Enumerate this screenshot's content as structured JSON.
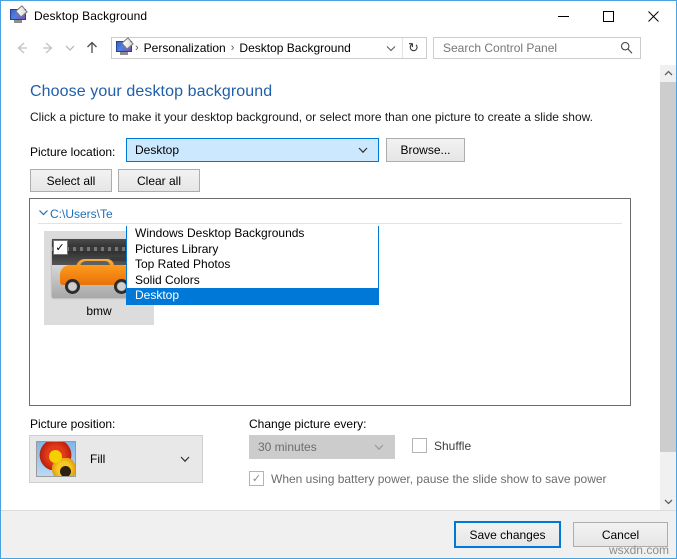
{
  "window": {
    "title": "Desktop Background",
    "icon": "desktop-background-icon",
    "controls": {
      "minimize": "minimize-icon",
      "maximize": "maximize-icon",
      "close": "close-icon"
    }
  },
  "nav": {
    "back": "back-arrow-icon",
    "forward": "forward-arrow-icon",
    "recent": "recent-locations-icon",
    "up": "up-arrow-icon",
    "breadcrumb": [
      "Personalization",
      "Desktop Background"
    ],
    "separator": "›",
    "dropdown": "address-dropdown-icon",
    "refresh": "refresh-icon"
  },
  "search": {
    "placeholder": "Search Control Panel",
    "value": "",
    "icon": "search-icon"
  },
  "page": {
    "title": "Choose your desktop background",
    "description": "Click a picture to make it your desktop background, or select more than one picture to create a slide show."
  },
  "picture_location": {
    "label": "Picture location:",
    "selected": "Desktop",
    "browse_label": "Browse...",
    "options": [
      "Windows Desktop Backgrounds",
      "Pictures Library",
      "Top Rated Photos",
      "Solid Colors",
      "Desktop"
    ]
  },
  "selection": {
    "select_all": "Select all",
    "clear_all": "Clear all"
  },
  "gallery": {
    "group_label": "C:\\Users\\Te",
    "group_chevron": "chevron-down-icon",
    "items": [
      {
        "label": "bmw",
        "checked": "✓",
        "thumbnail": "orange-bmw-car-photo"
      }
    ]
  },
  "picture_position": {
    "label": "Picture position:",
    "value": "Fill",
    "thumbnail": "flower-preview-icon",
    "chevron": "chevron-down-icon"
  },
  "change_picture": {
    "label": "Change picture every:",
    "interval": "30 minutes",
    "chevron": "chevron-down-icon",
    "shuffle_label": "Shuffle",
    "shuffle_checked": "",
    "battery_label": "When using battery power, pause the slide show to save power",
    "battery_checked": "✓"
  },
  "footer": {
    "save_label": "Save changes",
    "cancel_label": "Cancel",
    "watermark": "wsxdn.com"
  },
  "colors": {
    "accent": "#0078d7",
    "title_blue": "#1f5fa9",
    "link_blue": "#1f6fb8"
  }
}
